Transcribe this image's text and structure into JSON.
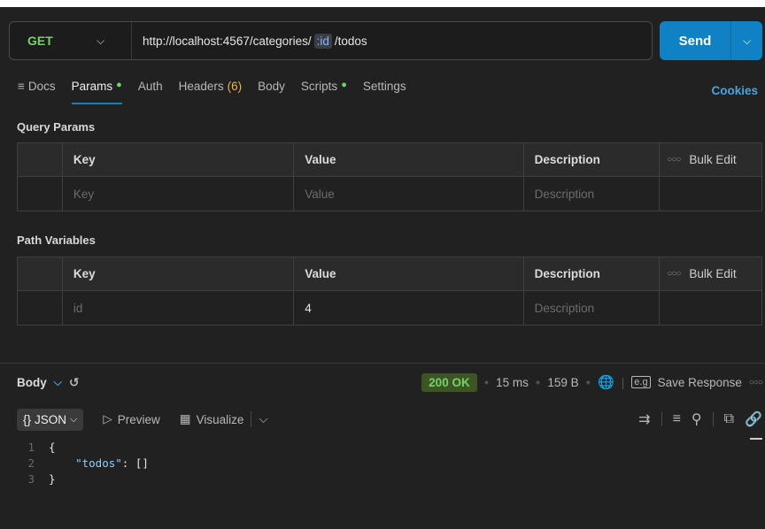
{
  "request": {
    "method": "GET",
    "url_prefix": "http://localhost:4567/categories/",
    "url_var": ":id",
    "url_suffix": "/todos",
    "send_label": "Send"
  },
  "tabs": [
    {
      "label": "Docs"
    },
    {
      "label": "Params",
      "dot": "●"
    },
    {
      "label": "Auth"
    },
    {
      "label": "Headers",
      "count": "(6)"
    },
    {
      "label": "Body"
    },
    {
      "label": "Scripts",
      "dot": "●"
    },
    {
      "label": "Settings"
    }
  ],
  "cookies_label": "Cookies",
  "query_params": {
    "title": "Query Params",
    "headers": [
      "Key",
      "Value",
      "Description",
      "Bulk Edit"
    ],
    "rows": [
      {
        "key": "Key",
        "value": "Value",
        "description": "Description"
      }
    ]
  },
  "path_variables": {
    "title": "Path Variables",
    "headers": [
      "Key",
      "Value",
      "Description",
      "Bulk Edit"
    ],
    "rows": [
      {
        "key": "id",
        "value": "4",
        "description": "Description"
      }
    ]
  },
  "response": {
    "label": "Body",
    "status": "200 OK",
    "time": "15 ms",
    "size": "159 B",
    "save_label": "Save Response",
    "format_label": "JSON",
    "preview_label": "Preview",
    "visualize_label": "Visualize",
    "code_lines": [
      {
        "n": "1",
        "text": "{"
      },
      {
        "n": "2",
        "key": "\"todos\"",
        "rest": ": []"
      },
      {
        "n": "3",
        "text": "}"
      }
    ]
  },
  "colors": {
    "accent": "#0f81c4",
    "method_get": "#73d36a",
    "status_ok": "#73d36a",
    "cookies": "#4aa3e0"
  }
}
